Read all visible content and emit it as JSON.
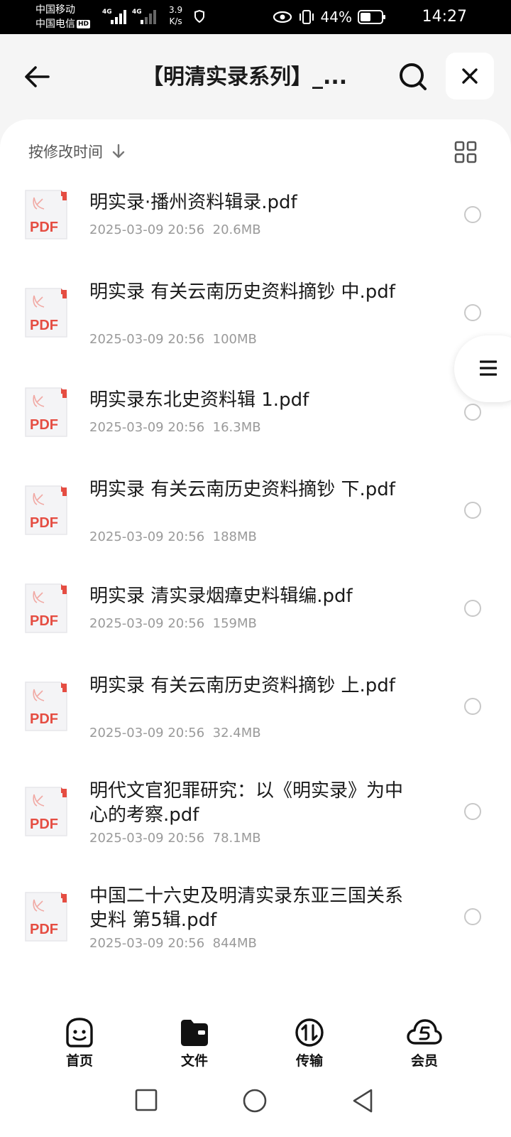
{
  "status_bar": {
    "carrier1": "中国移动",
    "carrier2": "中国电信",
    "hd_badge": "HD",
    "net1": "4G",
    "net2": "4G",
    "speed_value": "3.9",
    "speed_unit": "K/s",
    "battery": "44%",
    "time": "14:27"
  },
  "header": {
    "title": "【明清实录系列】_..."
  },
  "toolbar": {
    "sort_label": "按修改时间"
  },
  "files": [
    {
      "name": "明实录·播州资料辑录.pdf",
      "date": "2025-03-09 20:56",
      "size": "20.6MB"
    },
    {
      "name": "明实录  有关云南历史资料摘钞 中.pdf",
      "date": "2025-03-09 20:56",
      "size": "100MB"
    },
    {
      "name": "明实录东北史资料辑  1.pdf",
      "date": "2025-03-09 20:56",
      "size": "16.3MB"
    },
    {
      "name": "明实录  有关云南历史资料摘钞 下.pdf",
      "date": "2025-03-09 20:56",
      "size": "188MB"
    },
    {
      "name": "明实录  清实录烟瘴史料辑编.pdf",
      "date": "2025-03-09 20:56",
      "size": "159MB"
    },
    {
      "name": "明实录  有关云南历史资料摘钞 上.pdf",
      "date": "2025-03-09 20:56",
      "size": "32.4MB"
    },
    {
      "name": "明代文官犯罪研究：以《明实录》为中心的考察.pdf",
      "date": "2025-03-09 20:56",
      "size": "78.1MB"
    },
    {
      "name": "中国二十六史及明清实录东亚三国关系史料  第5辑.pdf",
      "date": "2025-03-09 20:56",
      "size": "844MB"
    }
  ],
  "pdf_label": "PDF",
  "bottom_nav": {
    "home": "首页",
    "files": "文件",
    "transfer": "传输",
    "vip": "会员"
  },
  "colors": {
    "pdf_red": "#e54d42",
    "background": "#f5f5f5"
  }
}
